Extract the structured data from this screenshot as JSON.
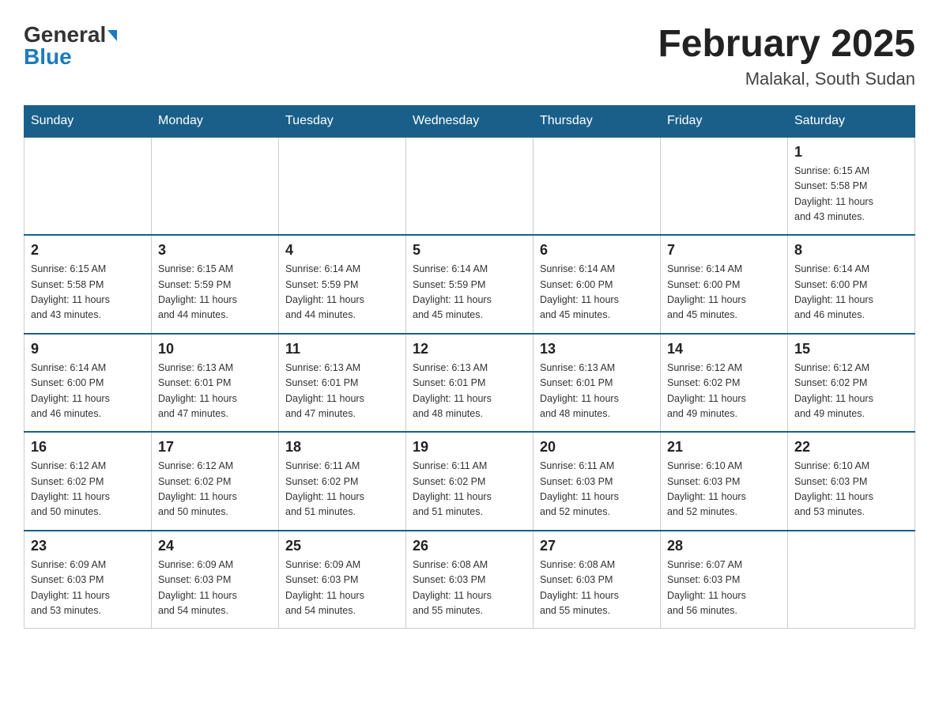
{
  "header": {
    "logo_general": "General",
    "logo_blue": "Blue",
    "month_title": "February 2025",
    "location": "Malakal, South Sudan"
  },
  "weekdays": [
    "Sunday",
    "Monday",
    "Tuesday",
    "Wednesday",
    "Thursday",
    "Friday",
    "Saturday"
  ],
  "weeks": [
    [
      {
        "day": "",
        "info": "",
        "empty": true
      },
      {
        "day": "",
        "info": "",
        "empty": true
      },
      {
        "day": "",
        "info": "",
        "empty": true
      },
      {
        "day": "",
        "info": "",
        "empty": true
      },
      {
        "day": "",
        "info": "",
        "empty": true
      },
      {
        "day": "",
        "info": "",
        "empty": true
      },
      {
        "day": "1",
        "info": "Sunrise: 6:15 AM\nSunset: 5:58 PM\nDaylight: 11 hours\nand 43 minutes.",
        "empty": false
      }
    ],
    [
      {
        "day": "2",
        "info": "Sunrise: 6:15 AM\nSunset: 5:58 PM\nDaylight: 11 hours\nand 43 minutes.",
        "empty": false
      },
      {
        "day": "3",
        "info": "Sunrise: 6:15 AM\nSunset: 5:59 PM\nDaylight: 11 hours\nand 44 minutes.",
        "empty": false
      },
      {
        "day": "4",
        "info": "Sunrise: 6:14 AM\nSunset: 5:59 PM\nDaylight: 11 hours\nand 44 minutes.",
        "empty": false
      },
      {
        "day": "5",
        "info": "Sunrise: 6:14 AM\nSunset: 5:59 PM\nDaylight: 11 hours\nand 45 minutes.",
        "empty": false
      },
      {
        "day": "6",
        "info": "Sunrise: 6:14 AM\nSunset: 6:00 PM\nDaylight: 11 hours\nand 45 minutes.",
        "empty": false
      },
      {
        "day": "7",
        "info": "Sunrise: 6:14 AM\nSunset: 6:00 PM\nDaylight: 11 hours\nand 45 minutes.",
        "empty": false
      },
      {
        "day": "8",
        "info": "Sunrise: 6:14 AM\nSunset: 6:00 PM\nDaylight: 11 hours\nand 46 minutes.",
        "empty": false
      }
    ],
    [
      {
        "day": "9",
        "info": "Sunrise: 6:14 AM\nSunset: 6:00 PM\nDaylight: 11 hours\nand 46 minutes.",
        "empty": false
      },
      {
        "day": "10",
        "info": "Sunrise: 6:13 AM\nSunset: 6:01 PM\nDaylight: 11 hours\nand 47 minutes.",
        "empty": false
      },
      {
        "day": "11",
        "info": "Sunrise: 6:13 AM\nSunset: 6:01 PM\nDaylight: 11 hours\nand 47 minutes.",
        "empty": false
      },
      {
        "day": "12",
        "info": "Sunrise: 6:13 AM\nSunset: 6:01 PM\nDaylight: 11 hours\nand 48 minutes.",
        "empty": false
      },
      {
        "day": "13",
        "info": "Sunrise: 6:13 AM\nSunset: 6:01 PM\nDaylight: 11 hours\nand 48 minutes.",
        "empty": false
      },
      {
        "day": "14",
        "info": "Sunrise: 6:12 AM\nSunset: 6:02 PM\nDaylight: 11 hours\nand 49 minutes.",
        "empty": false
      },
      {
        "day": "15",
        "info": "Sunrise: 6:12 AM\nSunset: 6:02 PM\nDaylight: 11 hours\nand 49 minutes.",
        "empty": false
      }
    ],
    [
      {
        "day": "16",
        "info": "Sunrise: 6:12 AM\nSunset: 6:02 PM\nDaylight: 11 hours\nand 50 minutes.",
        "empty": false
      },
      {
        "day": "17",
        "info": "Sunrise: 6:12 AM\nSunset: 6:02 PM\nDaylight: 11 hours\nand 50 minutes.",
        "empty": false
      },
      {
        "day": "18",
        "info": "Sunrise: 6:11 AM\nSunset: 6:02 PM\nDaylight: 11 hours\nand 51 minutes.",
        "empty": false
      },
      {
        "day": "19",
        "info": "Sunrise: 6:11 AM\nSunset: 6:02 PM\nDaylight: 11 hours\nand 51 minutes.",
        "empty": false
      },
      {
        "day": "20",
        "info": "Sunrise: 6:11 AM\nSunset: 6:03 PM\nDaylight: 11 hours\nand 52 minutes.",
        "empty": false
      },
      {
        "day": "21",
        "info": "Sunrise: 6:10 AM\nSunset: 6:03 PM\nDaylight: 11 hours\nand 52 minutes.",
        "empty": false
      },
      {
        "day": "22",
        "info": "Sunrise: 6:10 AM\nSunset: 6:03 PM\nDaylight: 11 hours\nand 53 minutes.",
        "empty": false
      }
    ],
    [
      {
        "day": "23",
        "info": "Sunrise: 6:09 AM\nSunset: 6:03 PM\nDaylight: 11 hours\nand 53 minutes.",
        "empty": false
      },
      {
        "day": "24",
        "info": "Sunrise: 6:09 AM\nSunset: 6:03 PM\nDaylight: 11 hours\nand 54 minutes.",
        "empty": false
      },
      {
        "day": "25",
        "info": "Sunrise: 6:09 AM\nSunset: 6:03 PM\nDaylight: 11 hours\nand 54 minutes.",
        "empty": false
      },
      {
        "day": "26",
        "info": "Sunrise: 6:08 AM\nSunset: 6:03 PM\nDaylight: 11 hours\nand 55 minutes.",
        "empty": false
      },
      {
        "day": "27",
        "info": "Sunrise: 6:08 AM\nSunset: 6:03 PM\nDaylight: 11 hours\nand 55 minutes.",
        "empty": false
      },
      {
        "day": "28",
        "info": "Sunrise: 6:07 AM\nSunset: 6:03 PM\nDaylight: 11 hours\nand 56 minutes.",
        "empty": false
      },
      {
        "day": "",
        "info": "",
        "empty": true
      }
    ]
  ]
}
